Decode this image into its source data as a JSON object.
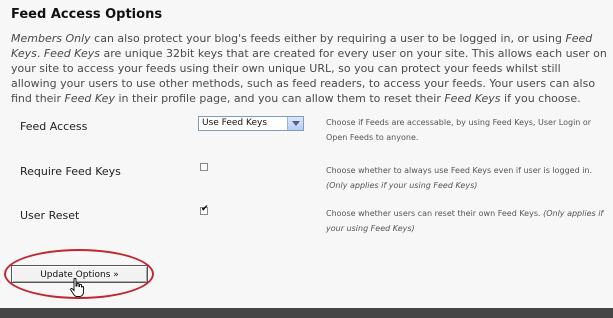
{
  "page": {
    "title": "Feed Access Options",
    "intro": {
      "p1_em": "Members Only",
      "p2": " can also protect your blog's feeds either by requiring a user to be logged in, or using ",
      "p3_em": "Feed Keys",
      "p4": ". ",
      "p5_em": "Feed Keys",
      "p6": " are unique 32bit keys that are created for every user on your site. This allows each user on your site to access your feeds using their own unique URL, so you can protect your feeds whilst still allowing your users to use other methods, such as feed readers, to access your feeds. Your users can also find their ",
      "p7_em": "Feed Key",
      "p8": " in their profile page, and you can allow them to reset their ",
      "p9_em": "Feed Keys",
      "p10": " if you choose."
    }
  },
  "options": {
    "feed_access": {
      "label": "Feed Access",
      "selected": "Use Feed Keys",
      "description": "Choose if Feeds are accessable, by using Feed Keys, User Login or Open Feeds to anyone."
    },
    "require_feed_keys": {
      "label": "Require Feed Keys",
      "checked": false,
      "description": "Choose whether to always use Feed Keys even if user is logged in.",
      "note": "(Only applies if your using Feed Keys)"
    },
    "user_reset": {
      "label": "User Reset",
      "checked": true,
      "check_glyph": "✔",
      "description": "Choose whether users can reset their own Feed Keys. ",
      "note": "(Only applies if your using Feed Keys)"
    }
  },
  "actions": {
    "update_label": "Update Options »"
  },
  "colors": {
    "highlight": "#c1272d",
    "footer": "#464646"
  },
  "icons": {
    "cursor": "hand-pointer-icon",
    "dropdown": "chevron-down-icon"
  }
}
